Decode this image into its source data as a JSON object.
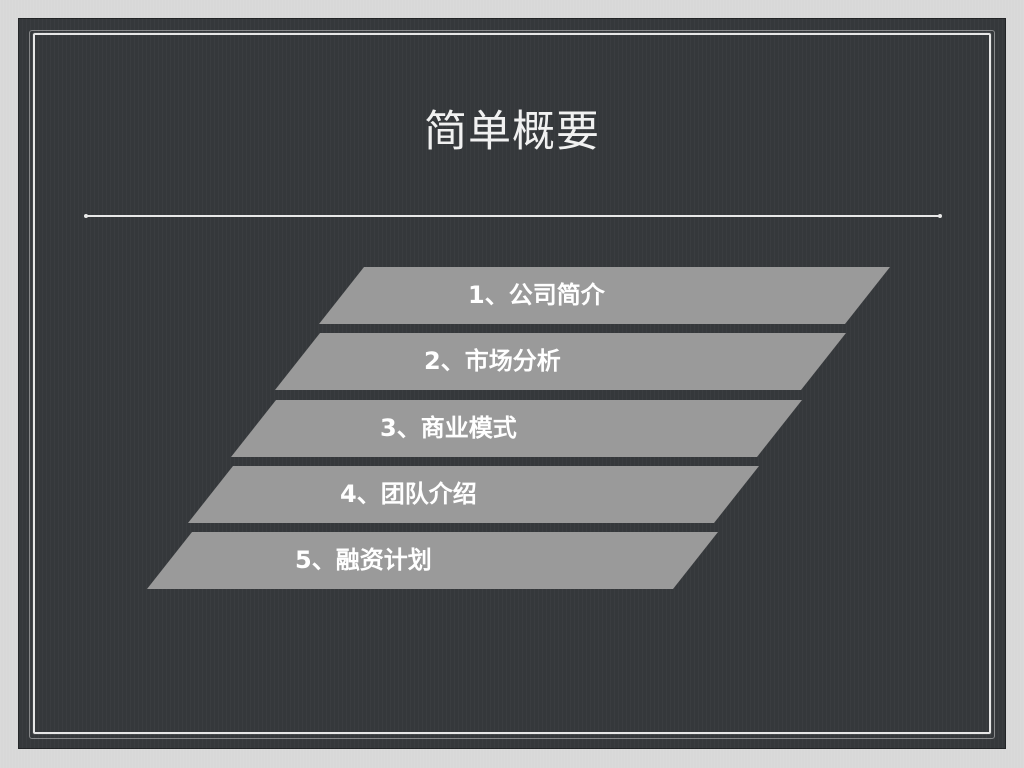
{
  "slide": {
    "title": "简单概要",
    "agenda": [
      {
        "label": "1、公司简介"
      },
      {
        "label": "2、市场分析"
      },
      {
        "label": "3、商业模式"
      },
      {
        "label": "4、团队介绍"
      },
      {
        "label": "5、融资计划"
      }
    ]
  },
  "colors": {
    "background": "#d8d8d8",
    "board": "#35383b",
    "chalk": "#e8e8e8",
    "agenda_band": "#9a9a9a",
    "agenda_text": "#ffffff"
  }
}
